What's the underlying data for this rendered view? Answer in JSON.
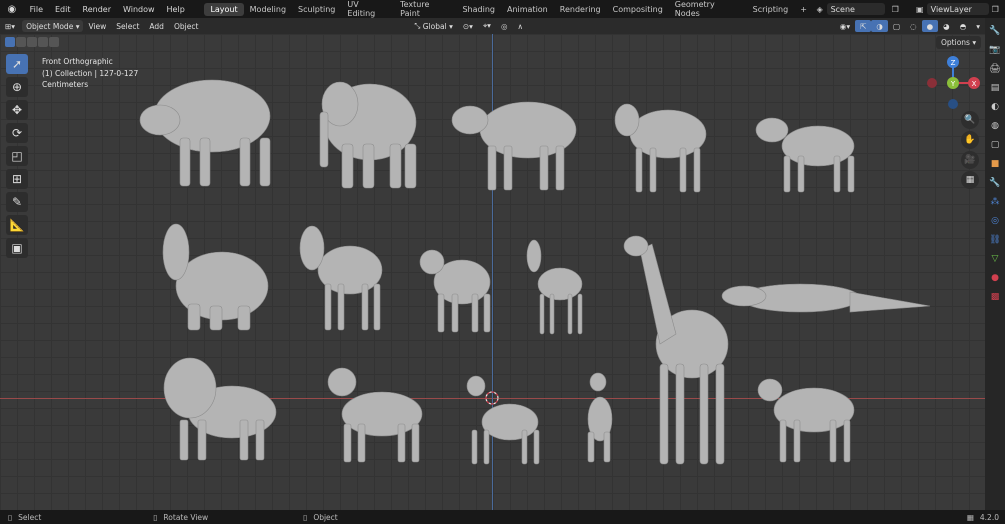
{
  "menu": [
    "File",
    "Edit",
    "Render",
    "Window",
    "Help"
  ],
  "workspaces": [
    "Layout",
    "Modeling",
    "Sculpting",
    "UV Editing",
    "Texture Paint",
    "Shading",
    "Animation",
    "Rendering",
    "Compositing",
    "Geometry Nodes",
    "Scripting"
  ],
  "active_workspace": "Layout",
  "scene": {
    "label": "Scene"
  },
  "viewlayer": {
    "label": "ViewLayer"
  },
  "header": {
    "mode": "Object Mode",
    "view": "View",
    "select": "Select",
    "add": "Add",
    "object": "Object",
    "transform": "Global"
  },
  "viewport_info": {
    "line1": "Front Orthographic",
    "line2": "(1) Collection | 127-0-127",
    "line3": "Centimeters"
  },
  "options_label": "Options",
  "gizmo": {
    "x": "X",
    "y": "Y",
    "z": "Z"
  },
  "status": {
    "select": "Select",
    "rotate": "Rotate View",
    "object": "Object",
    "version": "4.2.0"
  },
  "colors": {
    "accent": "#4772b3",
    "x_axis": "#d1404f",
    "y_axis": "#8bbf3a",
    "z_axis": "#3e7fd8",
    "model": "#b4b4b4"
  }
}
